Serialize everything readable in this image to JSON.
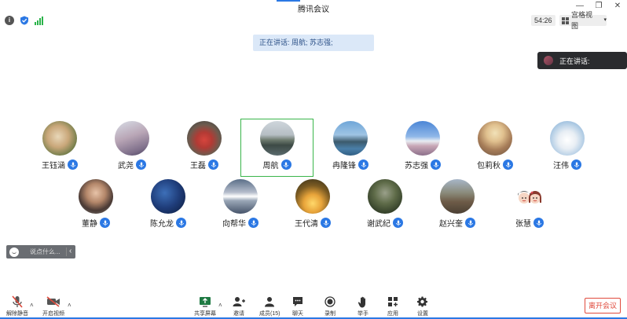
{
  "app": {
    "title": "腾讯会议"
  },
  "topbar": {
    "timer": "54:26",
    "view_label": "宫格视图"
  },
  "speaking": {
    "banner": "正在讲话: 周航; 苏志强;",
    "panel_label": "正在讲话:"
  },
  "participants": [
    {
      "name": "王钰涵",
      "avatar": "curly-dog-photo"
    },
    {
      "name": "武尧",
      "avatar": "child-portrait-photo"
    },
    {
      "name": "王磊",
      "avatar": "family-photo"
    },
    {
      "name": "周航",
      "avatar": "lake-city-photo",
      "highlighted": true
    },
    {
      "name": "冉隆锋",
      "avatar": "bridge-lake-photo"
    },
    {
      "name": "苏志强",
      "avatar": "snow-mountain-photo"
    },
    {
      "name": "包莉秋",
      "avatar": "woman-hat-photo"
    },
    {
      "name": "汪伟",
      "avatar": "arctic-fox-photo"
    },
    {
      "name": "董静",
      "avatar": "woman-portrait-photo"
    },
    {
      "name": "陈允龙",
      "avatar": "silhouette-night-photo"
    },
    {
      "name": "向帮华",
      "avatar": "sunset-river-photo"
    },
    {
      "name": "王代清",
      "avatar": "tree-sunset-photo"
    },
    {
      "name": "谢武纪",
      "avatar": "forest-photo"
    },
    {
      "name": "赵兴奎",
      "avatar": "group-outdoor-photo"
    },
    {
      "name": "张慧",
      "avatar": "cartoon-couple-sticker"
    }
  ],
  "chat": {
    "placeholder": "说点什么..."
  },
  "toolbar": {
    "unmute": "解除静音",
    "start_video": "开启视频",
    "share_screen": "共享屏幕",
    "invite": "邀请",
    "members": "成员(15)",
    "chat": "聊天",
    "record": "录制",
    "raise_hand": "举手",
    "apps": "应用",
    "settings": "设置",
    "leave": "离开会议"
  },
  "colors": {
    "accent": "#2b78e4",
    "speaking_highlight": "#39b54a",
    "leave": "#e04a3c"
  }
}
